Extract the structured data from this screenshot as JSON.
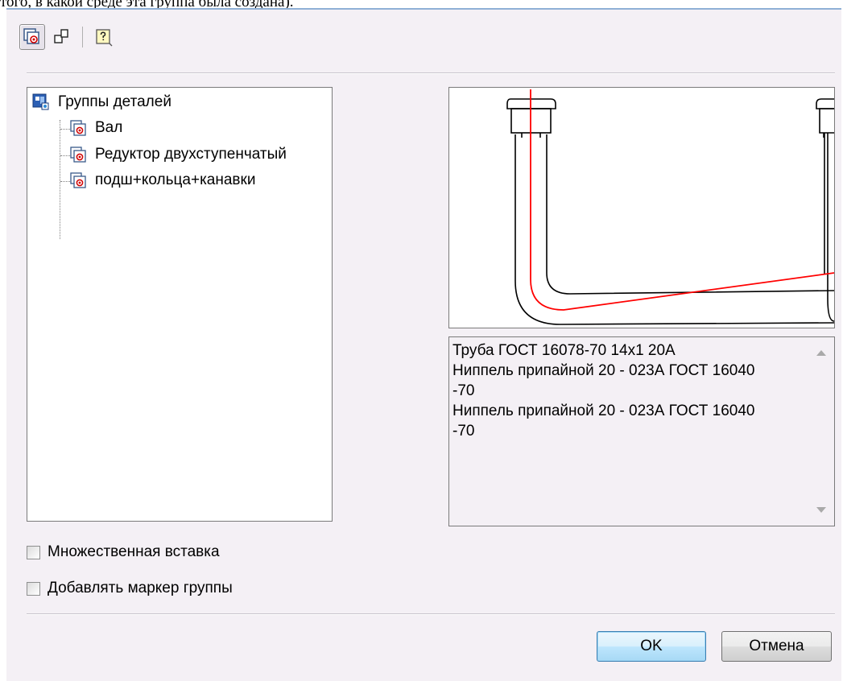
{
  "header_fragment": "того, в какой среде эта группа была создана).",
  "toolbar": {
    "buttons": [
      {
        "icon": "group-view-icon",
        "pressed": true
      },
      {
        "icon": "layout-icon",
        "pressed": false
      },
      {
        "icon": "help-icon",
        "pressed": false
      }
    ]
  },
  "tree": {
    "root": {
      "label": "Группы деталей",
      "icon": "groups-root-icon"
    },
    "items": [
      {
        "label": "Вал",
        "icon": "detail-group-icon"
      },
      {
        "label": "Редуктор двухступенчатый",
        "icon": "detail-group-icon"
      },
      {
        "label": "подш+кольца+канавки",
        "icon": "detail-group-icon"
      }
    ]
  },
  "preview": {
    "accent_color": "#ff0000"
  },
  "info": {
    "lines": [
      "Труба ГОСТ 16078-70 14х1 20А",
      "Ниппель припайной 20 - 023А ГОСТ 16040",
      "-70",
      "Ниппель припайной 20 - 023А ГОСТ 16040",
      "-70"
    ]
  },
  "options": {
    "multiple_insert_label": "Множественная вставка",
    "multiple_insert_checked": false,
    "add_group_marker_label": "Добавлять маркер группы",
    "add_group_marker_checked": false
  },
  "buttons": {
    "ok_label": "OK",
    "cancel_label": "Отмена"
  }
}
